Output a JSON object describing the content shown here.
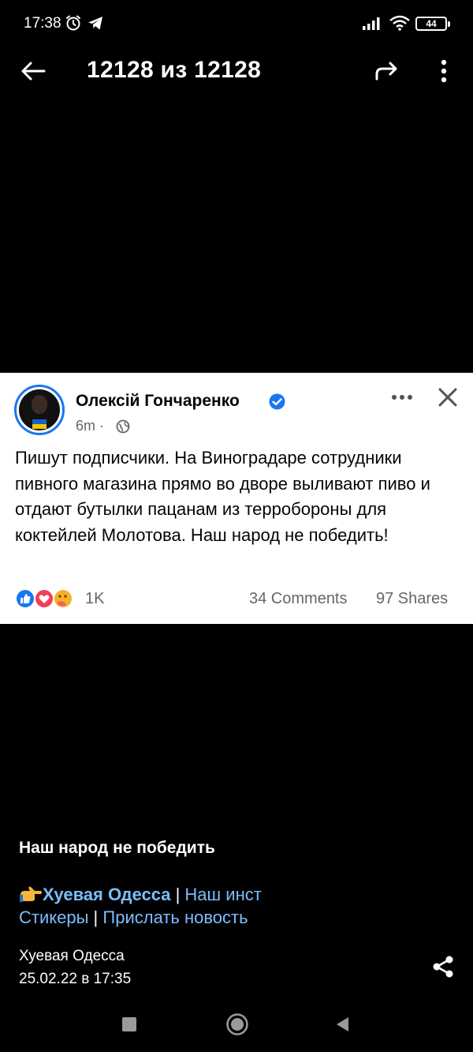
{
  "status_bar": {
    "time": "17:38",
    "battery": "44",
    "icons": [
      "alarm-icon",
      "telegram-icon",
      "signal-icon",
      "wifi-icon",
      "battery-icon"
    ]
  },
  "toolbar": {
    "title": "12128 из 12128",
    "icons": [
      "back-arrow-icon",
      "forward-share-icon",
      "more-vertical-icon"
    ]
  },
  "post": {
    "author": "Олексій Гончаренко",
    "time": "6m",
    "separator": "·",
    "text": "Пишут подписчики. На Виноградаре сотрудники пивного магазина прямо во дворе выливают пиво и отдают бутылки пацанам из терробороны для коктейлей Молотова. Наш народ не победить!",
    "reaction_count": "1K",
    "comments": "34 Comments",
    "shares": "97 Shares",
    "colors": {
      "accent": "#1877f2",
      "text": "#050505",
      "muted": "#65676b"
    }
  },
  "caption": {
    "title": "Наш народ не победить",
    "link_channel": "Хуевая Одесса",
    "sep": "|",
    "link_inst": "Наш инст",
    "link_stickers": "Стикеры",
    "link_submit": "Прислать новость"
  },
  "footer": {
    "channel": "Хуевая Одесса",
    "date": "25.02.22 в 17:35"
  },
  "colors": {
    "background": "#000000",
    "link": "#7cbdff"
  }
}
